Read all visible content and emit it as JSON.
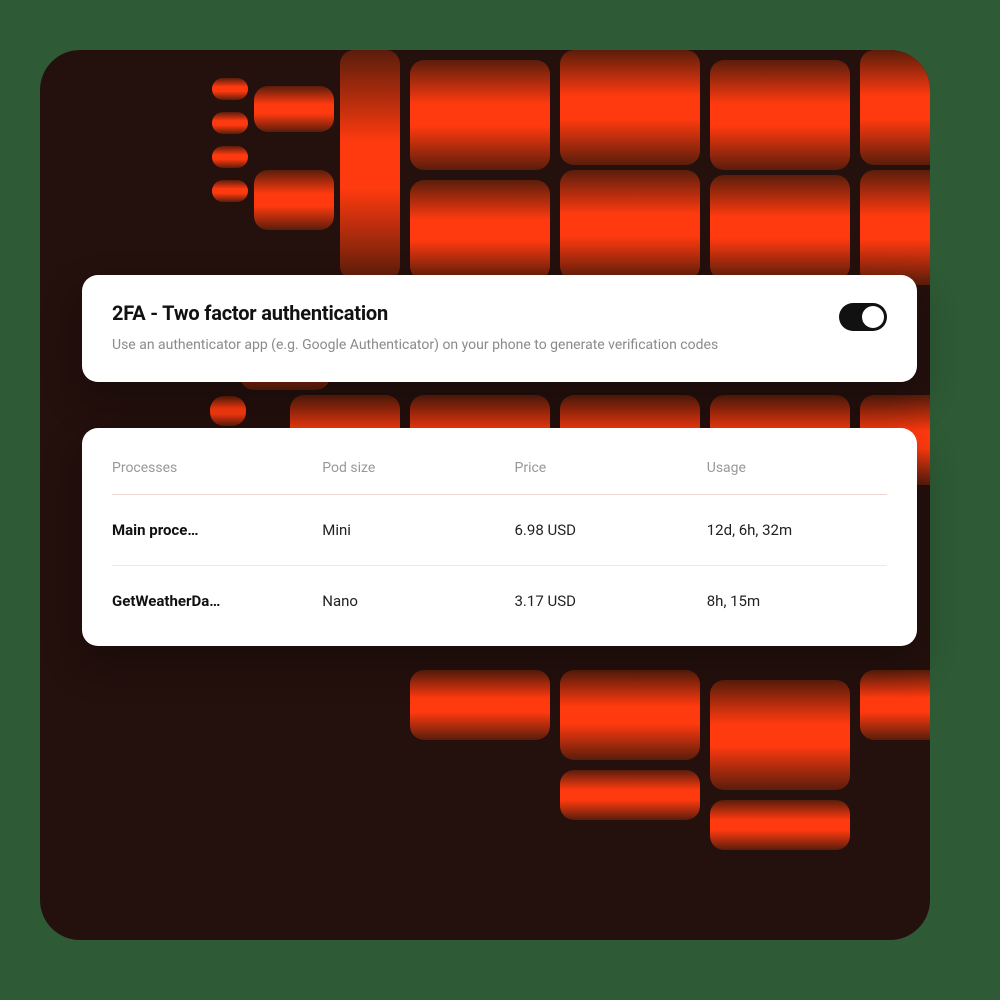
{
  "twofa": {
    "title": "2FA - Two factor authentication",
    "description": "Use an authenticator app (e.g. Google Authenticator) on your phone to generate verification codes",
    "enabled": true
  },
  "table": {
    "headers": {
      "processes": "Processes",
      "pod_size": "Pod size",
      "price": "Price",
      "usage": "Usage"
    },
    "rows": [
      {
        "process": "Main proce…",
        "pod_size": "Mini",
        "price": "6.98 USD",
        "usage": "12d, 6h, 32m"
      },
      {
        "process": "GetWeatherDa…",
        "pod_size": "Nano",
        "price": "3.17 USD",
        "usage": "8h, 15m"
      }
    ]
  },
  "colors": {
    "page_bg": "#2e5a35",
    "panel_bg": "#24100d",
    "accent_grad_from": "#5a1d0b",
    "accent_grad_to": "#ff3a0f"
  }
}
